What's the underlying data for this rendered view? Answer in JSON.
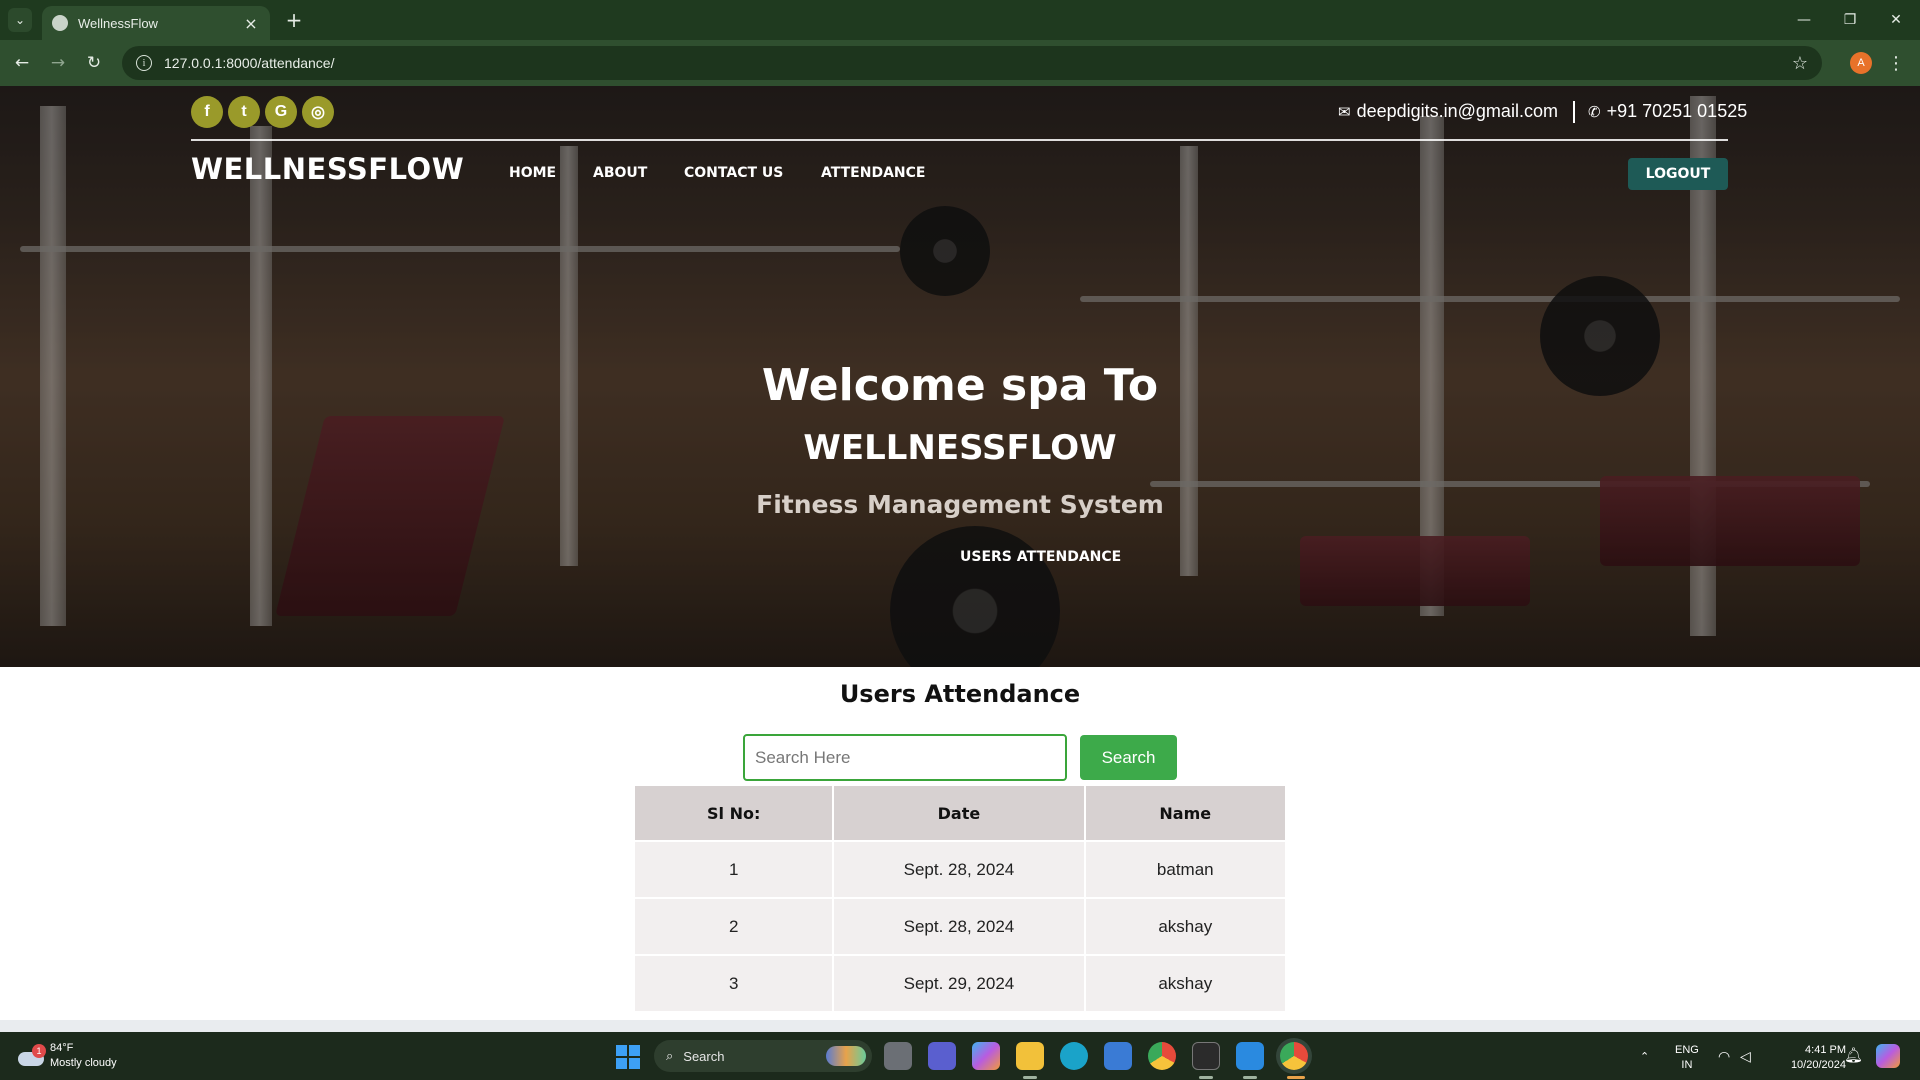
{
  "browser": {
    "tab_title": "WellnessFlow",
    "url": "127.0.0.1:8000/attendance/",
    "profile_initial": "A",
    "icons": {
      "tab_menu": "chevron-down-icon",
      "new_tab": "plus-icon",
      "close_tab": "close-icon",
      "back": "arrow-left-icon",
      "forward": "arrow-right-icon",
      "reload": "reload-icon",
      "site_info": "info-icon",
      "bookmark": "star-icon",
      "menu": "kebab-icon"
    }
  },
  "site": {
    "brand": "WELLNESSFLOW",
    "email": "deepdigits.in@gmail.com",
    "phone": "+91 70251 01525",
    "social": [
      {
        "name": "facebook-icon",
        "glyph": "f"
      },
      {
        "name": "twitter-icon",
        "glyph": "t"
      },
      {
        "name": "google-icon",
        "glyph": "G"
      },
      {
        "name": "instagram-icon",
        "glyph": "◎"
      }
    ],
    "nav": [
      "HOME",
      "ABOUT",
      "CONTACT US",
      "ATTENDANCE"
    ],
    "logout": "LOGOUT",
    "social_color": "#9a9a2a",
    "logout_color": "#1e5a56"
  },
  "hero": {
    "line1": "Welcome spa To",
    "line2": "WELLNESSFLOW",
    "line3": "Fitness Management System",
    "breadcrumb": "USERS ATTENDANCE"
  },
  "attendance": {
    "title": "Users Attendance",
    "search_placeholder": "Search Here",
    "search_button": "Search",
    "accent": "#3daa4a",
    "columns": [
      "Sl No:",
      "Date",
      "Name"
    ],
    "rows": [
      [
        "1",
        "Sept. 28, 2024",
        "batman"
      ],
      [
        "2",
        "Sept. 28, 2024",
        "akshay"
      ],
      [
        "3",
        "Sept. 29, 2024",
        "akshay"
      ]
    ]
  },
  "taskbar": {
    "weather_temp": "84°F",
    "weather_desc": "Mostly cloudy",
    "weather_badge": "1",
    "search_label": "Search",
    "lang_top": "ENG",
    "lang_bottom": "IN",
    "time": "4:41 PM",
    "date": "10/20/2024"
  }
}
